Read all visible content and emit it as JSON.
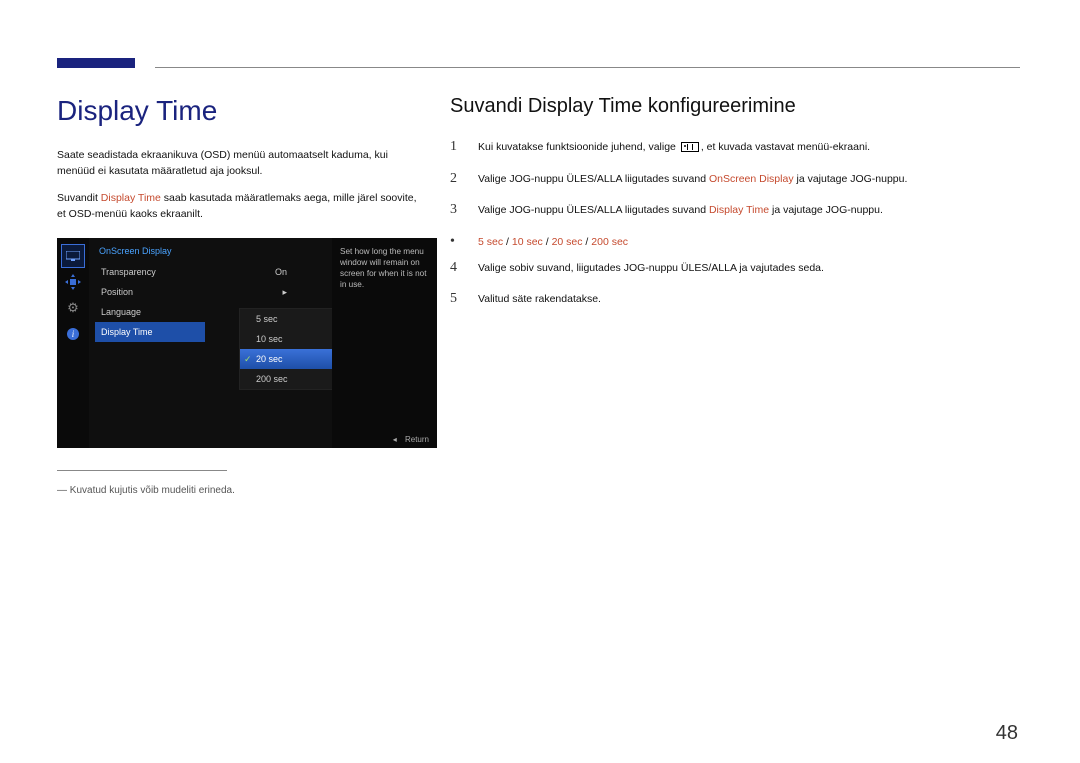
{
  "header": {
    "left_title": "Display Time",
    "right_title": "Suvandi Display Time konﬁgureerimine"
  },
  "left": {
    "para1a": "Saate seadistada ekraanikuva (OSD) menüü automaatselt kaduma, kui menüüd ei kasutata määratletud aja jooksul.",
    "para2_pre": "Suvandit ",
    "para2_kw": "Display Time",
    "para2_post": " saab kasutada määratlemaks aega, mille järel soovite, et OSD-menüü kaoks ekraanilt.",
    "osd": {
      "title": "OnScreen Display",
      "items": [
        {
          "label": "Transparency",
          "value": "On"
        },
        {
          "label": "Position",
          "value": "▸"
        },
        {
          "label": "Language",
          "value": "▸"
        },
        {
          "label": "Display Time",
          "value": ""
        }
      ],
      "submenu": [
        "5 sec",
        "10 sec",
        "20 sec",
        "200 sec"
      ],
      "submenu_selected_index": 2,
      "help": "Set how long the menu window will remain on screen for when it is not in use.",
      "footer_return": "Return"
    },
    "footnote_dash": "―",
    "footnote": "Kuvatud kujutis võib mudeliti erineda."
  },
  "right": {
    "steps": [
      {
        "num": "1",
        "pre": "Kui kuvatakse funktsioonide juhend, valige ",
        "icon": true,
        "post": ", et kuvada vastavat menüü-ekraani."
      },
      {
        "num": "2",
        "pre": "Valige JOG-nuppu ÜLES/ALLA liigutades suvand ",
        "kw": "OnScreen Display",
        "post": " ja vajutage JOG-nuppu."
      },
      {
        "num": "3",
        "pre": "Valige JOG-nuppu ÜLES/ALLA liigutades suvand ",
        "kw": "Display Time",
        "post": " ja vajutage JOG-nuppu."
      },
      {
        "num": "4",
        "pre": "Valige sobiv suvand, liigutades JOG-nuppu ÜLES/ALLA ja vajutades seda.",
        "kw": "",
        "post": ""
      },
      {
        "num": "5",
        "pre": "Valitud säte rakendatakse.",
        "kw": "",
        "post": ""
      }
    ],
    "options_note_values": [
      "5 sec",
      "10 sec",
      "20 sec",
      "200 sec"
    ],
    "options_sep": " / "
  },
  "page_number": "48"
}
